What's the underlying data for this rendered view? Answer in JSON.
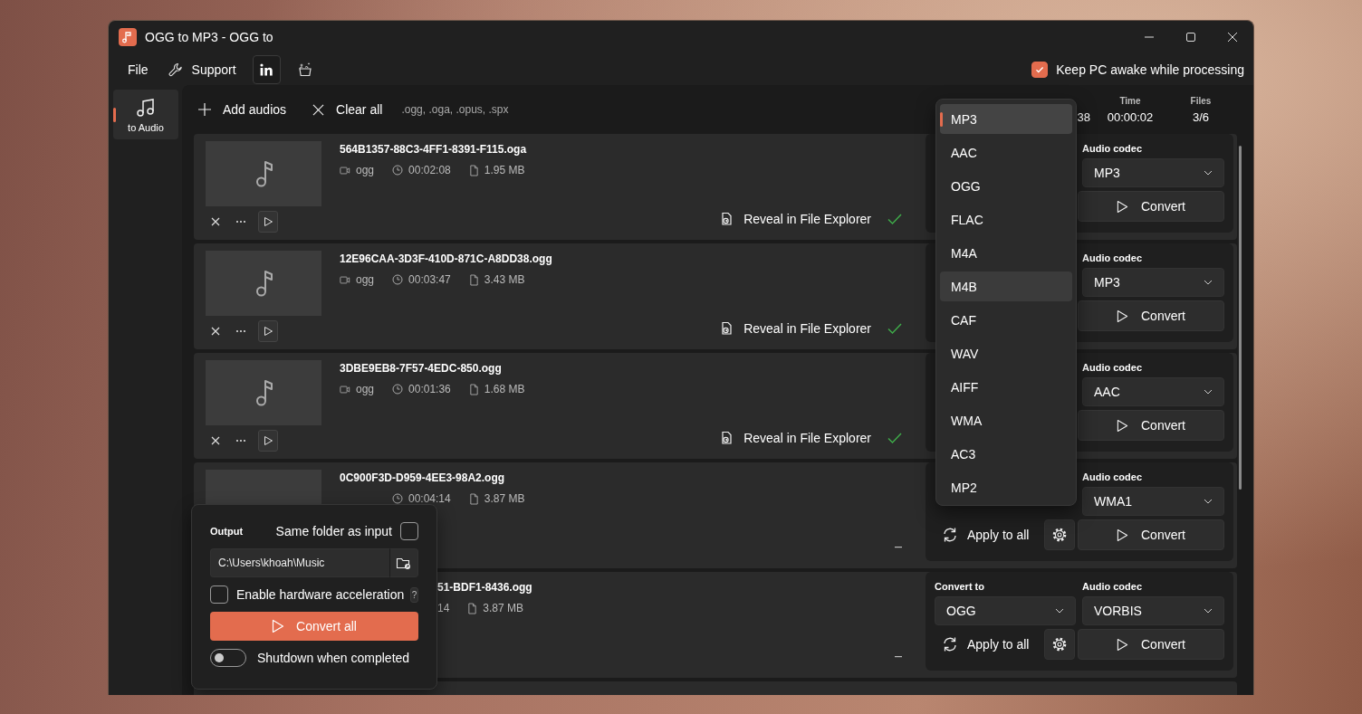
{
  "window": {
    "title": "OGG to MP3 - OGG to"
  },
  "menu": [
    {
      "label": "File",
      "kind": "text"
    },
    {
      "label": "Support",
      "kind": "wrench"
    }
  ],
  "keep_awake": {
    "label": "Keep PC awake while processing",
    "checked": true
  },
  "nav": [
    {
      "label": "to Audio",
      "selected": true
    }
  ],
  "toolbar": {
    "add": "Add audios",
    "clear": "Clear all",
    "extensions": ".ogg, .oga, .opus, .spx"
  },
  "stats": [
    {
      "value": "38"
    },
    {
      "label": "Time",
      "value": "00:00:02"
    },
    {
      "label": "Files",
      "value": "3/6"
    }
  ],
  "files": [
    {
      "kind": "file",
      "name": "564B1357-88C3-4FF1-8391-F115.oga",
      "format": "ogg",
      "duration": "00:02:08",
      "size": "1.95 MB",
      "done": true,
      "reveal": "Reveal in File Explorer",
      "codec_label": "Audio codec",
      "codec": "MP3",
      "convert": "Convert"
    },
    {
      "kind": "file",
      "name": "12E96CAA-3D3F-410D-871C-A8DD38.ogg",
      "format": "ogg",
      "duration": "00:03:47",
      "size": "3.43 MB",
      "done": true,
      "reveal": "Reveal in File Explorer",
      "codec_label": "Audio codec",
      "codec": "MP3",
      "convert": "Convert"
    },
    {
      "kind": "file",
      "name": "3DBE9EB8-7F57-4EDC-850.ogg",
      "format": "ogg",
      "duration": "00:01:36",
      "size": "1.68 MB",
      "done": true,
      "reveal": "Reveal in File Explorer",
      "codec_label": "Audio codec",
      "codec": "AAC",
      "convert": "Convert"
    },
    {
      "kind": "file_under_popup_top",
      "name": "0C900F3D-D959-4EE3-98A2.ogg",
      "duration": "00:04:14",
      "size": "3.87 MB",
      "done": false,
      "codec_label": "Audio codec",
      "codec": "WMA1",
      "apply": "Apply to all",
      "convert": "Convert"
    },
    {
      "kind": "file_under_popup_side",
      "name": "51-BDF1-8436.ogg",
      "duration": "14",
      "size": "3.87 MB",
      "done": false,
      "convert_to_label": "Convert to",
      "convert_to": "OGG",
      "codec_label": "Audio codec",
      "codec": "VORBIS",
      "apply": "Apply to all",
      "convert": "Convert"
    },
    {
      "kind": "cut"
    }
  ],
  "format_menu": {
    "items": [
      {
        "label": "MP3",
        "selected": true,
        "hovered": false
      },
      {
        "label": "AAC",
        "selected": false,
        "hovered": false
      },
      {
        "label": "OGG",
        "selected": false,
        "hovered": false
      },
      {
        "label": "FLAC",
        "selected": false,
        "hovered": false
      },
      {
        "label": "M4A",
        "selected": false,
        "hovered": false
      },
      {
        "label": "M4B",
        "selected": false,
        "hovered": true
      },
      {
        "label": "CAF",
        "selected": false,
        "hovered": false
      },
      {
        "label": "WAV",
        "selected": false,
        "hovered": false
      },
      {
        "label": "AIFF",
        "selected": false,
        "hovered": false
      },
      {
        "label": "WMA",
        "selected": false,
        "hovered": false
      },
      {
        "label": "AC3",
        "selected": false,
        "hovered": false
      },
      {
        "label": "MP2",
        "selected": false,
        "hovered": false
      }
    ]
  },
  "output": {
    "label": "Output",
    "same_folder": {
      "label": "Same folder as input",
      "checked": false
    },
    "path": "C:\\Users\\khoah\\Music",
    "hw_accel": {
      "label": "Enable hardware acceleration",
      "checked": false
    },
    "help": "?",
    "convert_all": "Convert all",
    "shutdown": {
      "label": "Shutdown when completed",
      "on": false
    }
  }
}
